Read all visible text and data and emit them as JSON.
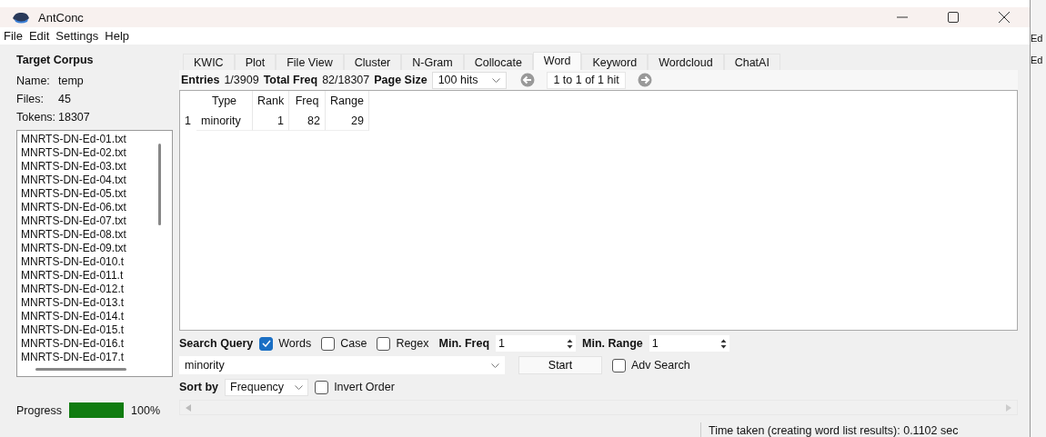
{
  "window": {
    "title": "AntConc"
  },
  "menu": [
    "File",
    "Edit",
    "Settings",
    "Help"
  ],
  "corpus": {
    "heading": "Target Corpus",
    "name_label": "Name:",
    "name": "temp",
    "files_label": "Files:",
    "files": "45",
    "tokens_label": "Tokens:",
    "tokens": "18307",
    "file_list": [
      "MNRTS-DN-Ed-01.txt",
      "MNRTS-DN-Ed-02.txt",
      "MNRTS-DN-Ed-03.txt",
      "MNRTS-DN-Ed-04.txt",
      "MNRTS-DN-Ed-05.txt",
      "MNRTS-DN-Ed-06.txt",
      "MNRTS-DN-Ed-07.txt",
      "MNRTS-DN-Ed-08.txt",
      "MNRTS-DN-Ed-09.txt",
      "MNRTS-DN-Ed-010.t",
      "MNRTS-DN-Ed-011.t",
      "MNRTS-DN-Ed-012.t",
      "MNRTS-DN-Ed-013.t",
      "MNRTS-DN-Ed-014.t",
      "MNRTS-DN-Ed-015.t",
      "MNRTS-DN-Ed-016.t",
      "MNRTS-DN-Ed-017.t"
    ]
  },
  "progress": {
    "label": "Progress",
    "level": 1,
    "reading": "100%"
  },
  "tabs": [
    {
      "label": "KWIC",
      "selected": false
    },
    {
      "label": "Plot",
      "selected": false
    },
    {
      "label": "File View",
      "selected": false
    },
    {
      "label": "Cluster",
      "selected": false
    },
    {
      "label": "N-Gram",
      "selected": false
    },
    {
      "label": "Collocate",
      "selected": false
    },
    {
      "label": "Word",
      "selected": true
    },
    {
      "label": "Keyword",
      "selected": false
    },
    {
      "label": "Wordcloud",
      "selected": false
    },
    {
      "label": "ChatAI",
      "selected": false
    }
  ],
  "summary": {
    "entries_label": "Entries",
    "entries": "1/3909",
    "total_label": "Total Freq",
    "total": "82/18307",
    "page_size_label": "Page Size",
    "page_size": "100 hits",
    "hits": "1 to 1 of 1 hit"
  },
  "table": {
    "columns": [
      "Type",
      "Rank",
      "Freq",
      "Range"
    ],
    "rows": [
      {
        "index": "1",
        "cells": [
          "minority",
          "1",
          "82",
          "29"
        ]
      }
    ]
  },
  "search": {
    "label": "Search Query",
    "options": [
      {
        "label": "Words",
        "checked": true
      },
      {
        "label": "Case",
        "checked": false
      },
      {
        "label": "Regex",
        "checked": false
      }
    ],
    "min_freq_label": "Min. Freq",
    "min_freq": "1",
    "min_range_label": "Min. Range",
    "min_range": "1",
    "query": "minority",
    "start": "Start",
    "adv": {
      "label": "Adv Search",
      "checked": false
    }
  },
  "sort": {
    "label": "Sort by",
    "value": "Frequency",
    "invert": {
      "label": "Invert Order",
      "checked": false
    }
  },
  "status": "Time taken (creating word list results): 0.1102 sec",
  "background_window": [
    "Ed",
    "Ed"
  ]
}
